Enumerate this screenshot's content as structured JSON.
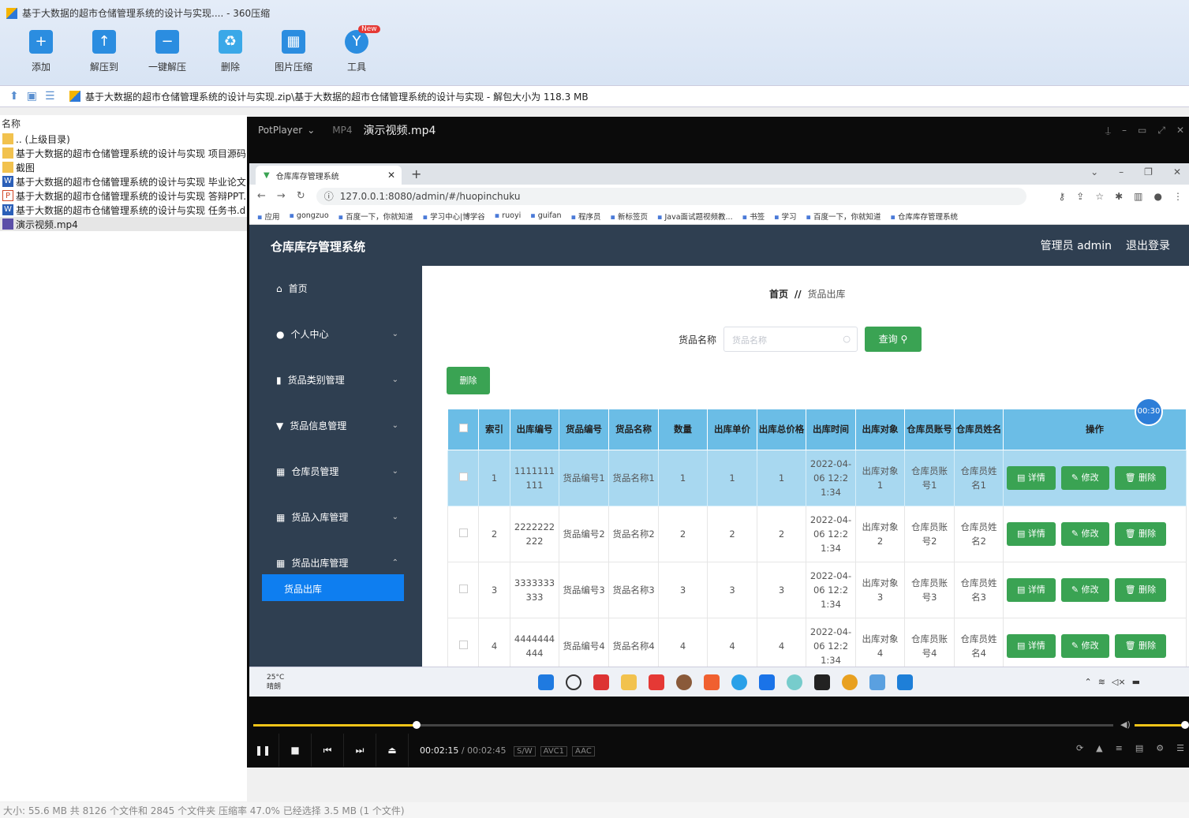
{
  "zip": {
    "title": "基于大数据的超市仓储管理系统的设计与实现.... - 360压缩",
    "toolbar": [
      "添加",
      "解压到",
      "一键解压",
      "删除",
      "图片压缩",
      "工具"
    ],
    "new_badge": "New",
    "path": "基于大数据的超市仓储管理系统的设计与实现.zip\\基于大数据的超市仓储管理系统的设计与实现 - 解包大小为 118.3 MB",
    "col_name": "名称",
    "files": [
      {
        "name": ".. (上级目录)",
        "type": "folder"
      },
      {
        "name": "基于大数据的超市仓储管理系统的设计与实现 项目源码",
        "type": "folder"
      },
      {
        "name": "截图",
        "type": "folder"
      },
      {
        "name": "基于大数据的超市仓储管理系统的设计与实现 毕业论文",
        "type": "word"
      },
      {
        "name": "基于大数据的超市仓储管理系统的设计与实现 答辩PPT.",
        "type": "ppt"
      },
      {
        "name": "基于大数据的超市仓储管理系统的设计与实现 任务书.d",
        "type": "word"
      },
      {
        "name": "演示视频.mp4",
        "type": "mp4"
      }
    ],
    "status": "大小: 55.6 MB 共 8126 个文件和 2845 个文件夹 压缩率 47.0% 已经选择 3.5 MB (1 个文件)"
  },
  "player": {
    "app": "PotPlayer",
    "format": "MP4",
    "filename": "演示视频.mp4",
    "time_current": "00:02:15",
    "time_total": "00:02:45",
    "pills": [
      "S/W",
      "AVC1",
      "AAC"
    ],
    "timer": "00:30",
    "progress_fraction": 0.19
  },
  "browser": {
    "tab_title": "仓库库存管理系统",
    "url": "127.0.0.1:8080/admin/#/huopinchuku",
    "bookmarks": [
      "应用",
      "gongzuo",
      "百度一下，你就知道",
      "学习中心|博学谷",
      "ruoyi",
      "guifan",
      "程序员",
      "新标签页",
      "Java面试题视频教...",
      "书签",
      "学习",
      "百度一下，你就知道",
      "仓库库存管理系统"
    ]
  },
  "app": {
    "title": "仓库库存管理系统",
    "user": "管理员 admin",
    "logout": "退出登录",
    "menu": [
      "首页",
      "个人中心",
      "货品类别管理",
      "货品信息管理",
      "仓库员管理",
      "货品入库管理",
      "货品出库管理"
    ],
    "submenu_active": "货品出库",
    "crumb_home": "首页",
    "crumb_sep": "//",
    "crumb_current": "货品出库",
    "search_label": "货品名称",
    "search_placeholder": "货品名称",
    "query_btn": "查询",
    "delete_btn": "删除",
    "columns": [
      "索引",
      "出库编号",
      "货品编号",
      "货品名称",
      "数量",
      "出库单价",
      "出库总价格",
      "出库时间",
      "出库对象",
      "仓库员账号",
      "仓库员姓名",
      "操作"
    ],
    "rows": [
      [
        "1",
        "1111111111",
        "货品编号1",
        "货品名称1",
        "1",
        "1",
        "1",
        "2022-04-06 12:21:34",
        "出库对象1",
        "仓库员账号1",
        "仓库员姓名1"
      ],
      [
        "2",
        "2222222222",
        "货品编号2",
        "货品名称2",
        "2",
        "2",
        "2",
        "2022-04-06 12:21:34",
        "出库对象2",
        "仓库员账号2",
        "仓库员姓名2"
      ],
      [
        "3",
        "3333333333",
        "货品编号3",
        "货品名称3",
        "3",
        "3",
        "3",
        "2022-04-06 12:21:34",
        "出库对象3",
        "仓库员账号3",
        "仓库员姓名3"
      ],
      [
        "4",
        "4444444444",
        "货品编号4",
        "货品名称4",
        "4",
        "4",
        "4",
        "2022-04-06 12:21:34",
        "出库对象4",
        "仓库员账号4",
        "仓库员姓名4"
      ]
    ],
    "actions": [
      "详情",
      "修改",
      "删除"
    ]
  },
  "taskbar": {
    "temp": "25°C",
    "weather": "晴朗"
  },
  "colors": {
    "accent_green": "#3aa353",
    "sidebar": "#2f3f51",
    "header_blue": "#6bbde6",
    "active_blue": "#0e7ef0"
  }
}
